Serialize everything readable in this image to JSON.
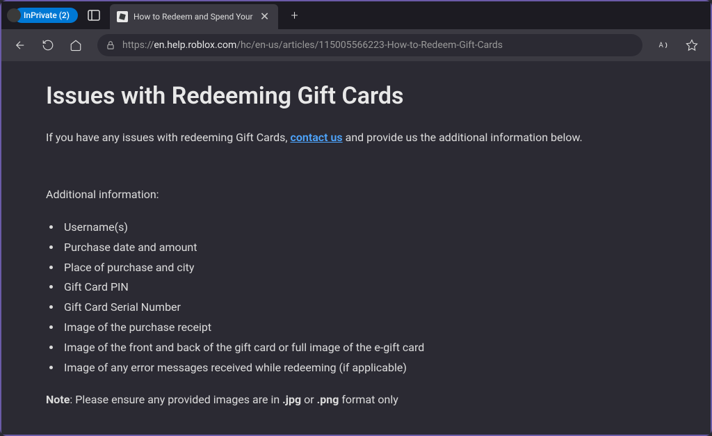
{
  "titlebar": {
    "inprivate_label": "InPrivate (2)",
    "tab_title": "How to Redeem and Spend Your"
  },
  "toolbar": {
    "url_prefix": "https://",
    "url_domain": "en.help.roblox.com",
    "url_path": "/hc/en-us/articles/115005566223-How-to-Redeem-Gift-Cards"
  },
  "content": {
    "heading": "Issues with Redeeming Gift Cards",
    "intro_before": "If you have any issues with redeeming Gift Cards, ",
    "intro_link": "contact us",
    "intro_after": " and provide us the additional information below.",
    "subheading": "Additional information:",
    "list": [
      "Username(s)",
      "Purchase date and amount",
      "Place of purchase and city",
      "Gift Card PIN",
      "Gift Card Serial Number",
      "Image of the purchase receipt",
      "Image of the front and back of the gift card or full image of the e-gift card",
      "Image of any error messages received while redeeming (if applicable)"
    ],
    "note_bold1": "Note",
    "note_mid1": ": Please ensure any provided images are in ",
    "note_bold2": ".jpg",
    "note_mid2": " or ",
    "note_bold3": ".png",
    "note_after": " format only"
  }
}
